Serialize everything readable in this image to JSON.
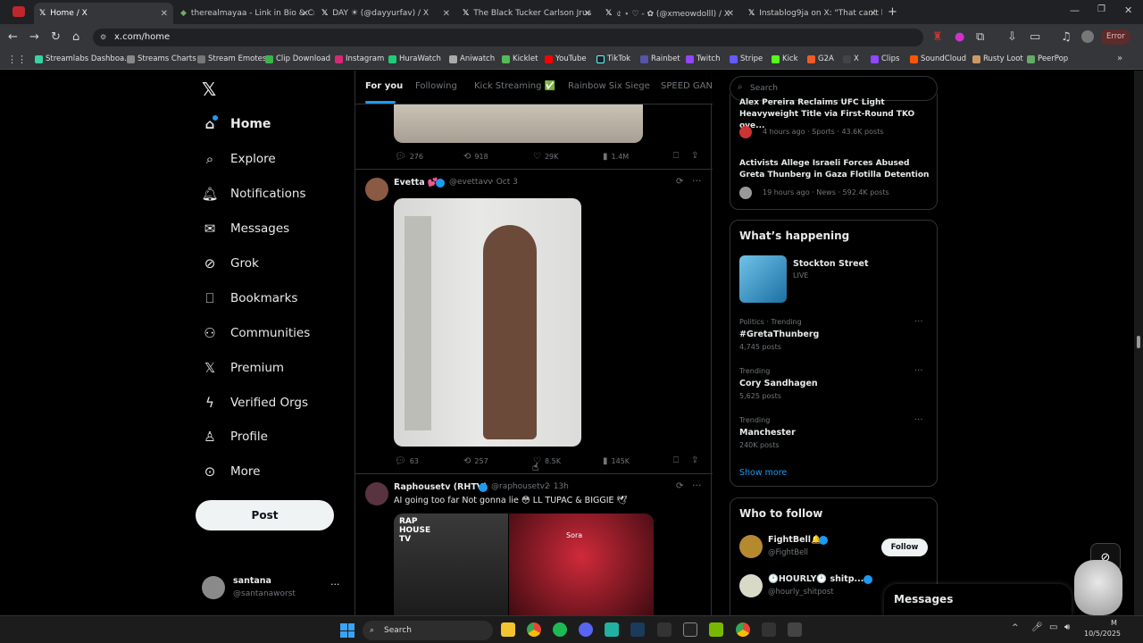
{
  "browser": {
    "tabs": [
      {
        "title": "Home / X",
        "active": true
      },
      {
        "title": "therealmayaa - Link in Bio & Cr"
      },
      {
        "title": "DAY ☀ (@dayyurfav) / X"
      },
      {
        "title": "The Black Tucker Carlson Jrus"
      },
      {
        "title": "৫ ⋆ ♡ - ✿ (@xmeowdolll) / X"
      },
      {
        "title": "Instablog9ja on X: \"That can't b"
      }
    ],
    "url": "x.com/home",
    "profile_label": "Error",
    "bookmarks": [
      "Streamlabs Dashboa...",
      "Streams Charts",
      "Stream Emotes",
      "Clip Download",
      "Instagram",
      "HuraWatch",
      "Aniwatch",
      "Kicklet",
      "YouTube",
      "TikTok",
      "Rainbet",
      "Twitch",
      "Stripe",
      "Kick",
      "G2A",
      "X",
      "Clips",
      "SoundCloud",
      "Rusty Loot",
      "PeerPop"
    ]
  },
  "sidebar": {
    "items": [
      {
        "label": "Home",
        "icon": "home-icon"
      },
      {
        "label": "Explore",
        "icon": "search-icon"
      },
      {
        "label": "Notifications",
        "icon": "bell-icon"
      },
      {
        "label": "Messages",
        "icon": "envelope-icon"
      },
      {
        "label": "Grok",
        "icon": "grok-icon"
      },
      {
        "label": "Bookmarks",
        "icon": "bookmark-icon"
      },
      {
        "label": "Communities",
        "icon": "people-icon"
      },
      {
        "label": "Premium",
        "icon": "x-logo-icon"
      },
      {
        "label": "Verified Orgs",
        "icon": "lightning-icon"
      },
      {
        "label": "Profile",
        "icon": "person-icon"
      },
      {
        "label": "More",
        "icon": "more-circle-icon"
      }
    ],
    "post_label": "Post",
    "account": {
      "name": "santana",
      "handle": "@santanaworst"
    }
  },
  "feed": {
    "tabs": [
      "For you",
      "Following",
      "Kick Streaming ✅",
      "Rainbow Six Siege",
      "SPEED GANG"
    ],
    "top_actions": {
      "replies": "276",
      "reposts": "918",
      "likes": "29K",
      "views": "1.4M"
    },
    "post1": {
      "name": "Evetta 💕",
      "handle": "@evettavv",
      "date": "· Oct 3",
      "replies": "63",
      "reposts": "257",
      "likes": "8.5K",
      "views": "145K"
    },
    "post2": {
      "name": "Raphousetv (RHTV)",
      "handle": "@raphousetv2",
      "date": "· 13h",
      "text": "AI going too far Not gonna lie 😳 LL TUPAC & BIGGIE 🕊",
      "img_left_text": "RAP HOUSE TV",
      "img_right_text": "Sora"
    }
  },
  "right": {
    "search_placeholder": "Search",
    "news": [
      {
        "title": "Alex Pereira Reclaims UFC Light Heavyweight Title via First-Round TKO ove...",
        "meta": "4 hours ago · Sports · 43.6K posts"
      },
      {
        "title": "Activists Allege Israeli Forces Abused Greta Thunberg in Gaza Flotilla Detention",
        "meta": "19 hours ago · News · 592.4K posts"
      }
    ],
    "happening_title": "What’s happening",
    "live": {
      "title": "Stockton Street",
      "status": "LIVE"
    },
    "trends": [
      {
        "context": "Politics · Trending",
        "name": "#GretaThunberg",
        "count": "4,745 posts"
      },
      {
        "context": "Trending",
        "name": "Cory Sandhagen",
        "count": "5,625 posts"
      },
      {
        "context": "Trending",
        "name": "Manchester",
        "count": "240K posts"
      }
    ],
    "show_more": "Show more",
    "who_title": "Who to follow",
    "follows": [
      {
        "name": "FightBell🔔",
        "handle": "@FightBell",
        "btn": "Follow"
      },
      {
        "name": "🕐HOURLY🕐 shitp...",
        "handle": "@hourly_shitpost",
        "btn": ""
      }
    ],
    "messages_label": "Messages"
  },
  "taskbar": {
    "search_label": "Search",
    "date": "10/5/2025",
    "time": "M"
  }
}
